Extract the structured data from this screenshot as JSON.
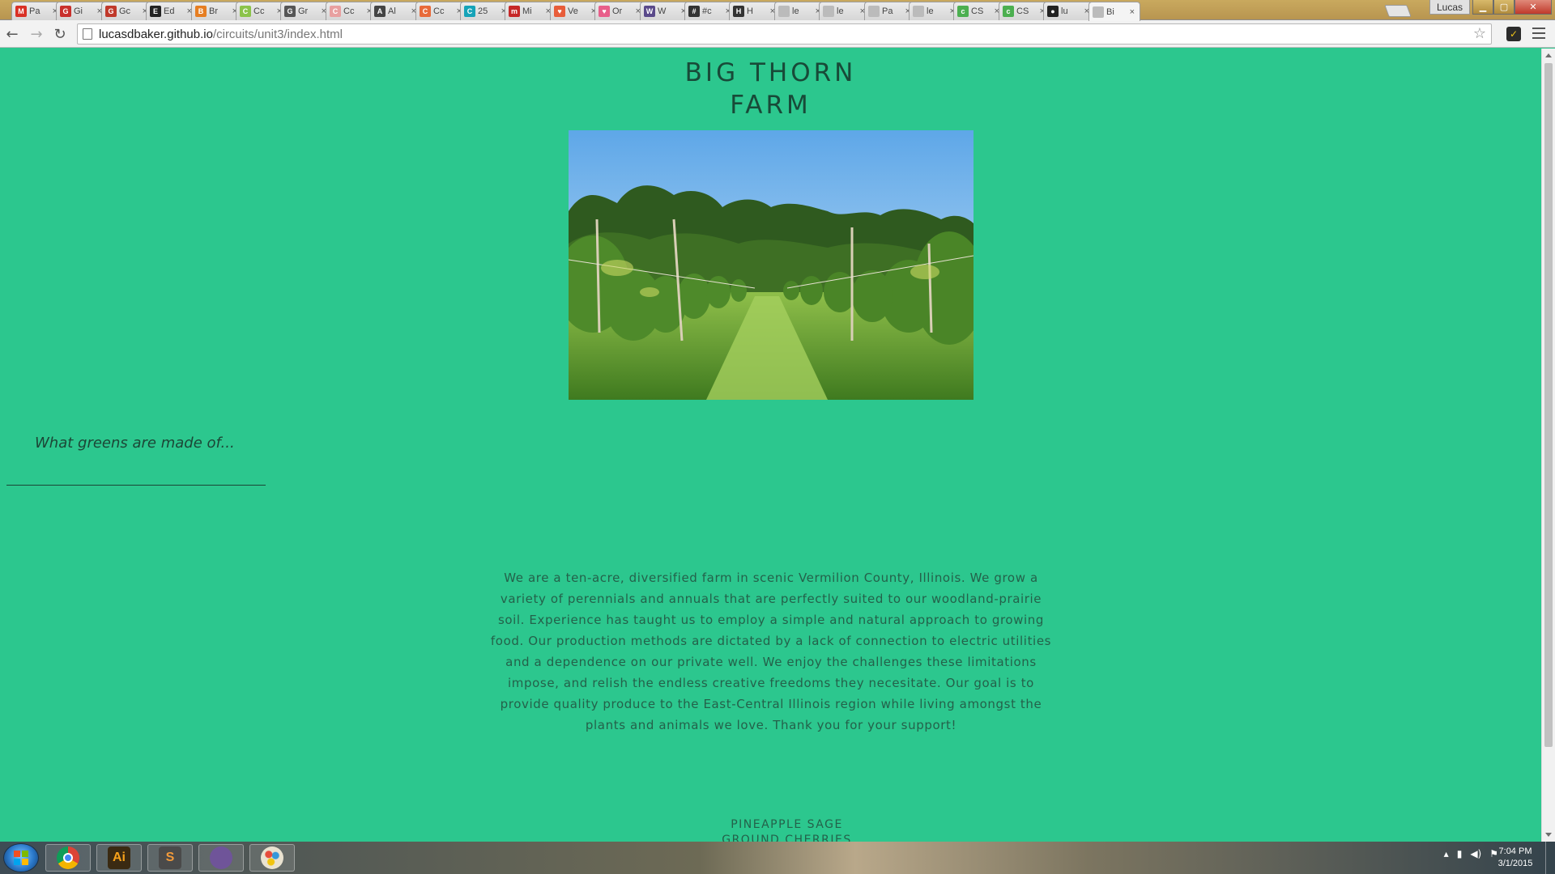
{
  "browser": {
    "tabs": [
      {
        "title": "Pa",
        "color": "#d93025",
        "glyph": "M"
      },
      {
        "title": "Gi",
        "color": "#c9302c",
        "glyph": "G"
      },
      {
        "title": "Gc",
        "color": "#c0392b",
        "glyph": "G"
      },
      {
        "title": "Ed",
        "color": "#222222",
        "glyph": "E"
      },
      {
        "title": "Br",
        "color": "#e67e22",
        "glyph": "B"
      },
      {
        "title": "Cc",
        "color": "#8bc34a",
        "glyph": "C"
      },
      {
        "title": "Gr",
        "color": "#555555",
        "glyph": "G"
      },
      {
        "title": "Cc",
        "color": "#e8a0a0",
        "glyph": "C"
      },
      {
        "title": "Al",
        "color": "#444444",
        "glyph": "A"
      },
      {
        "title": "Cc",
        "color": "#e86a3a",
        "glyph": "C"
      },
      {
        "title": "25",
        "color": "#16a3b8",
        "glyph": "C"
      },
      {
        "title": "Mi",
        "color": "#c62828",
        "glyph": "m"
      },
      {
        "title": "Ve",
        "color": "#e85d3a",
        "glyph": "♥"
      },
      {
        "title": "Or",
        "color": "#e85f8a",
        "glyph": "♥"
      },
      {
        "title": "W",
        "color": "#5a4a8a",
        "glyph": "W"
      },
      {
        "title": "#c",
        "color": "#333333",
        "glyph": "#"
      },
      {
        "title": "H",
        "color": "#333333",
        "glyph": "H"
      },
      {
        "title": "le",
        "color": "#bbbbbb",
        "glyph": ""
      },
      {
        "title": "le",
        "color": "#bbbbbb",
        "glyph": ""
      },
      {
        "title": "Pa",
        "color": "#bbbbbb",
        "glyph": ""
      },
      {
        "title": "le",
        "color": "#bbbbbb",
        "glyph": ""
      },
      {
        "title": "CS",
        "color": "#4caf50",
        "glyph": "c"
      },
      {
        "title": "CS",
        "color": "#4caf50",
        "glyph": "c"
      },
      {
        "title": "lu",
        "color": "#222222",
        "glyph": "●"
      },
      {
        "title": "Bi",
        "color": "#bbbbbb",
        "glyph": "",
        "active": true
      }
    ],
    "profile_name": "Lucas",
    "url_host": "lucasdbaker.github.io",
    "url_path": "/circuits/unit3/index.html"
  },
  "site": {
    "title_line1": "BIG THORN",
    "title_line2": "FARM",
    "tagline": "What greens are made of...",
    "about": "We are a ten-acre, diversified farm in scenic Vermilion County, Illinois. We grow a variety of perennials and annuals that are perfectly suited to our woodland-prairie soil. Experience has taught us to employ a simple and natural approach to growing food. Our production methods are dictated by a lack of connection to electric utilities and a dependence on our private well. We enjoy the challenges these limitations impose, and relish the endless creative freedoms they necesitate. Our goal is to provide quality produce to the East-Central Illinois region while living amongst the plants and animals we love. Thank you for your support!",
    "products": [
      "PINEAPPLE SAGE",
      "GROUND CHERRIES"
    ]
  },
  "taskbar": {
    "apps": [
      {
        "name": "chrome",
        "glyph": "",
        "bg": "#ffffff",
        "fg": "#000000"
      },
      {
        "name": "illustrator",
        "glyph": "Ai",
        "bg": "#3a2a12",
        "fg": "#f7a11a"
      },
      {
        "name": "sublime",
        "glyph": "S",
        "bg": "#4a4a4a",
        "fg": "#f29a3a"
      },
      {
        "name": "githubapp",
        "glyph": "",
        "bg": "#6f5499",
        "fg": "#ffffff"
      },
      {
        "name": "paint",
        "glyph": "",
        "bg": "#d7e9f7",
        "fg": "#333333"
      }
    ],
    "time": "7:04 PM",
    "date": "3/1/2015"
  },
  "colors": {
    "page_bg": "#2cc78e",
    "title_text": "#184a38",
    "body_text": "#24614a"
  }
}
